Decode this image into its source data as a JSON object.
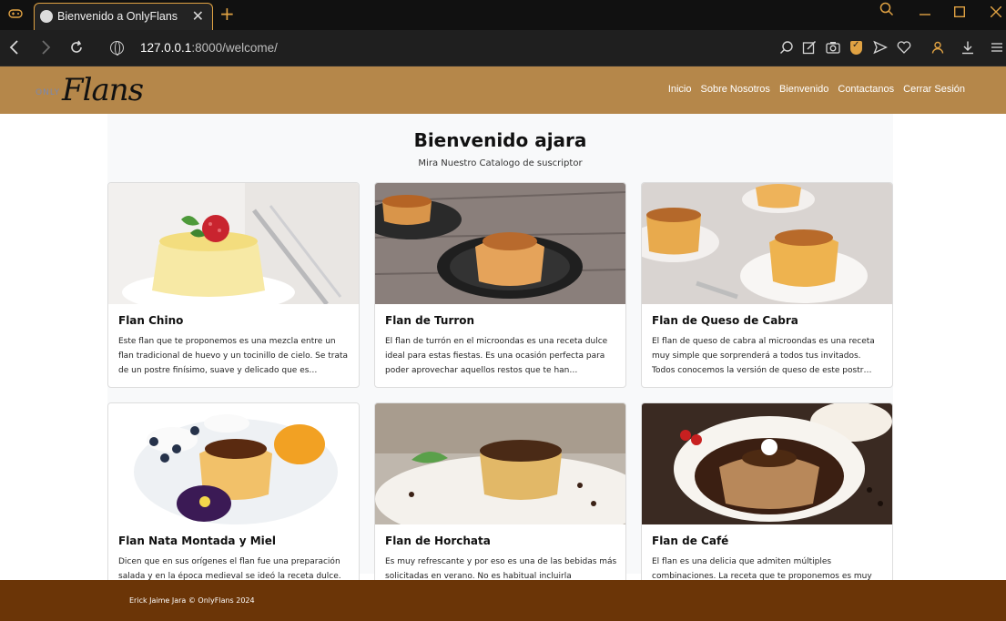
{
  "browser": {
    "tab_title": "Bienvenido a OnlyFlans",
    "tab_close": "✕",
    "new_tab": "+",
    "url_host": "127.0.0.1",
    "url_rest": ":8000/welcome/",
    "accent_color": "#e0a243"
  },
  "site": {
    "logo_prefix": "ONLY",
    "logo_main": "Flans",
    "nav": [
      "Inicio",
      "Sobre Nosotros",
      "Bienvenido",
      "Contactanos",
      "Cerrar Sesión"
    ],
    "heading": "Bienvenido ajara",
    "subheading": "Mira Nuestro Catalogo de suscriptor",
    "footer": "Erick Jaime Jara © OnlyFlans 2024",
    "colors": {
      "navbar": "#b5874a",
      "footer": "#6b3507",
      "page_bg": "#f8f9fa"
    }
  },
  "cards": [
    {
      "title": "Flan Chino",
      "text": "Este flan que te proponemos es una mezcla entre un flan tradicional de huevo y un tocinillo de cielo. Se trata de un postre finísimo, suave y delicado que es…"
    },
    {
      "title": "Flan de Turron",
      "text": "El flan de turrón en el microondas es una receta dulce ideal para estas fiestas. Es una ocasión perfecta para poder aprovechar aquellos restos que te han…"
    },
    {
      "title": "Flan de Queso de Cabra",
      "text": "El flan de queso de cabra al microondas es una receta muy simple que sorprenderá a todos tus invitados. Todos conocemos la versión de queso de este postr…"
    },
    {
      "title": "Flan Nata Montada y Miel",
      "text": "Dicen que en sus orígenes el flan fue una preparación salada y en la época medieval se ideó la receta dulce."
    },
    {
      "title": "Flan de Horchata",
      "text": "Es muy refrescante y por eso es una de las bebidas más solicitadas en verano. No es habitual incluirla"
    },
    {
      "title": "Flan de Café",
      "text": "El flan es una delicia que admiten múltiples combinaciones. La receta que te proponemos es muy"
    }
  ]
}
